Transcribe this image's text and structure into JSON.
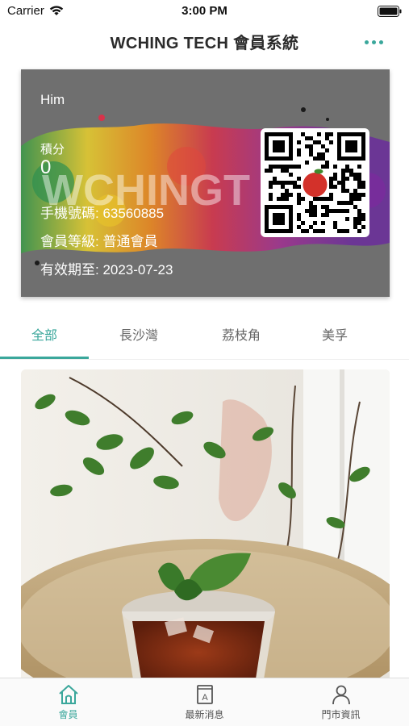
{
  "status_bar": {
    "carrier": "Carrier",
    "time": "3:00 PM"
  },
  "header": {
    "title": "WCHING TECH 會員系統",
    "more_icon": "more-dots-icon"
  },
  "member_card": {
    "name": "Him",
    "points_label": "積分",
    "points_value": "0",
    "phone": "手機號碼: 63560885",
    "level": "會員等級: 普通會員",
    "expiry": "有效期至: 2023-07-23",
    "watermark": "WCHINGT",
    "colors": {
      "card_bg": "#6f6f6f",
      "text": "#ffffff"
    }
  },
  "tabs": [
    {
      "label": "全部",
      "active": true
    },
    {
      "label": "長沙灣",
      "active": false
    },
    {
      "label": "荔枝角",
      "active": false
    },
    {
      "label": "美孚",
      "active": false
    }
  ],
  "bottom_nav": [
    {
      "label": "會員",
      "icon": "home-icon",
      "active": true
    },
    {
      "label": "最新消息",
      "icon": "news-icon",
      "active": false
    },
    {
      "label": "門市資訊",
      "icon": "person-icon",
      "active": false
    }
  ],
  "colors": {
    "accent": "#3aa79b",
    "header_text": "#2b2b2b",
    "tab_inactive": "#666666"
  }
}
